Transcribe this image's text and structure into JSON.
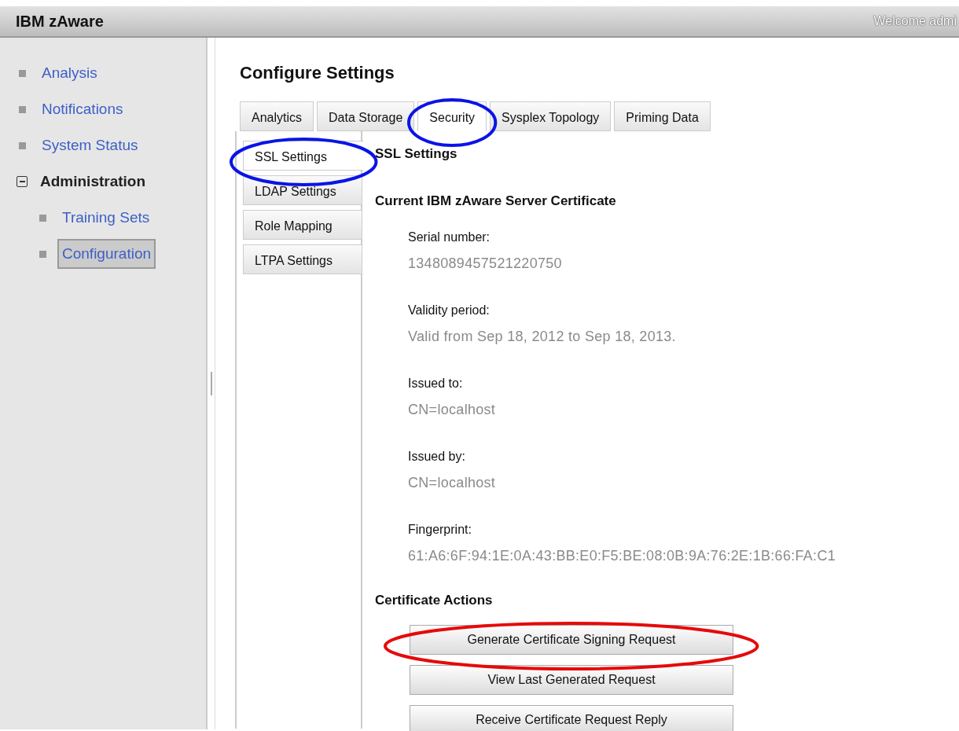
{
  "header": {
    "title": "IBM zAware",
    "welcome": "Welcome admi"
  },
  "sidebar": {
    "items": [
      {
        "label": "Analysis",
        "selected": false
      },
      {
        "label": "Notifications",
        "selected": false
      },
      {
        "label": "System Status",
        "selected": false
      },
      {
        "label": "Administration",
        "selected": false,
        "expanded": true,
        "children": [
          {
            "label": "Training Sets",
            "selected": false
          },
          {
            "label": "Configuration",
            "selected": true
          }
        ]
      }
    ]
  },
  "page_title": "Configure Settings",
  "tabs": [
    {
      "label": "Analytics",
      "selected": false
    },
    {
      "label": "Data Storage",
      "selected": false
    },
    {
      "label": "Security",
      "selected": true,
      "color": "#0a14e6"
    },
    {
      "label": "Sysplex Topology",
      "selected": false
    },
    {
      "label": "Priming Data",
      "selected": false
    }
  ],
  "side_tabs": [
    {
      "label": "SSL Settings",
      "selected": true,
      "color": "#0a14e6"
    },
    {
      "label": "LDAP Settings",
      "selected": false
    },
    {
      "label": "Role Mapping",
      "selected": false
    },
    {
      "label": "LTPA Settings",
      "selected": false
    }
  ],
  "panel": {
    "title": "SSL Settings",
    "section": "Current IBM zAware Server Certificate",
    "fields": [
      {
        "label": "Serial number:",
        "value": "1348089457521220750"
      },
      {
        "label": "Validity period:",
        "value": "Valid from Sep 18, 2012 to Sep 18, 2013."
      },
      {
        "label": "Issued to:",
        "value": "CN=localhost"
      },
      {
        "label": "Issued by:",
        "value": "CN=localhost"
      },
      {
        "label": "Fingerprint:",
        "value": "61:A6:6F:94:1E:0A:43:BB:E0:F5:BE:08:0B:9A:76:2E:1B:66:FA:C1"
      }
    ],
    "actions_title": "Certificate Actions",
    "actions": [
      {
        "label": "Generate Certificate Signing Request",
        "color": "#e60a0a"
      },
      {
        "label": "View Last Generated Request"
      },
      {
        "label": "Receive Certificate Request Reply"
      }
    ]
  }
}
